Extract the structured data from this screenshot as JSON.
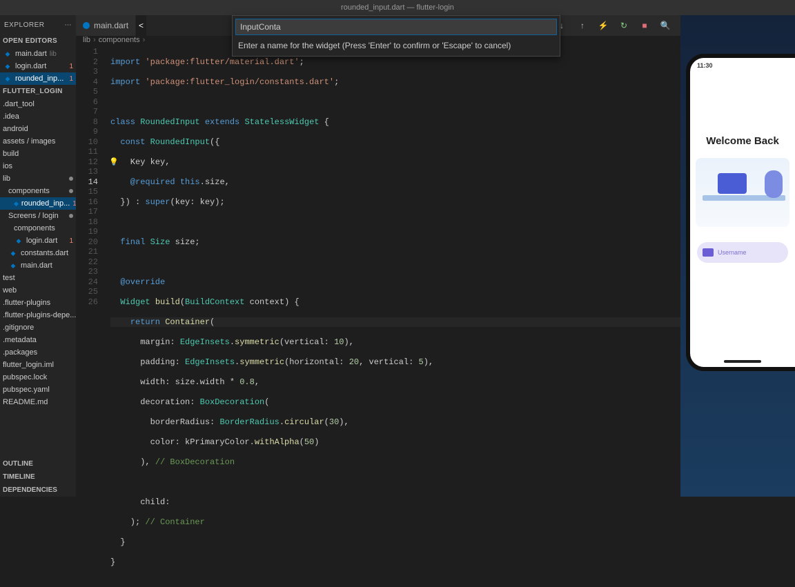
{
  "window_title": "rounded_input.dart — flutter-login",
  "sidebar": {
    "explorer_label": "EXPLORER",
    "open_editors_label": "OPEN EDITORS",
    "open_editors": [
      {
        "name": "main.dart",
        "hint": "lib",
        "error": ""
      },
      {
        "name": "login.dart",
        "hint": "...",
        "error": "1"
      },
      {
        "name": "rounded_inp...",
        "hint": "",
        "error": "1"
      }
    ],
    "project_label": "FLUTTER_LOGIN",
    "tree": [
      {
        "name": ".dart_tool",
        "type": "folder"
      },
      {
        "name": ".idea",
        "type": "folder"
      },
      {
        "name": "android",
        "type": "folder"
      },
      {
        "name": "assets / images",
        "type": "folder"
      },
      {
        "name": "build",
        "type": "folder"
      },
      {
        "name": "ios",
        "type": "folder"
      },
      {
        "name": "lib",
        "type": "folder-open",
        "mod": true
      },
      {
        "name": "components",
        "type": "folder-open",
        "mod": true,
        "indent": 1
      },
      {
        "name": "rounded_inp...",
        "type": "dart",
        "error": "1",
        "indent": 2,
        "selected": true
      },
      {
        "name": "Screens / login",
        "type": "folder-open",
        "mod": true,
        "indent": 1
      },
      {
        "name": "components",
        "type": "folder",
        "indent": 2
      },
      {
        "name": "login.dart",
        "type": "dart",
        "error": "1",
        "indent": 2
      },
      {
        "name": "constants.dart",
        "type": "dart",
        "indent": 1
      },
      {
        "name": "main.dart",
        "type": "dart",
        "indent": 1
      },
      {
        "name": "test",
        "type": "folder"
      },
      {
        "name": "web",
        "type": "folder"
      },
      {
        "name": ".flutter-plugins",
        "type": "file"
      },
      {
        "name": ".flutter-plugins-depe...",
        "type": "file"
      },
      {
        "name": ".gitignore",
        "type": "file"
      },
      {
        "name": ".metadata",
        "type": "file"
      },
      {
        "name": ".packages",
        "type": "file"
      },
      {
        "name": "flutter_login.iml",
        "type": "file"
      },
      {
        "name": "pubspec.lock",
        "type": "file"
      },
      {
        "name": "pubspec.yaml",
        "type": "file"
      },
      {
        "name": "README.md",
        "type": "file"
      }
    ],
    "panels": [
      "OUTLINE",
      "TIMELINE",
      "DEPENDENCIES"
    ]
  },
  "tabs": {
    "main": "main.dart",
    "active_indicator": "<"
  },
  "breadcrumb": [
    "lib",
    "components"
  ],
  "prompt": {
    "value": "InputConta",
    "hint": "Enter a name for the widget (Press 'Enter' to confirm or 'Escape' to cancel)"
  },
  "code": {
    "l1_import": "import ",
    "l1_str": "'package:flutter/material.dart'",
    "l1_end": ";",
    "l2_import": "import ",
    "l2_str": "'package:flutter_login/constants.dart'",
    "l2_end": ";",
    "l4_class": "class ",
    "l4_name": "RoundedInput ",
    "l4_extends": "extends ",
    "l4_parent": "StatelessWidget ",
    "l4_end": "{",
    "l5_const": "  const ",
    "l5_name": "RoundedInput",
    "l5_end": "({",
    "l6": "    Key key,",
    "l7_req": "    @required ",
    "l7_this": "this",
    "l7_end": ".size,",
    "l8_a": "  }) : ",
    "l8_super": "super",
    "l8_end": "(key: key);",
    "l10_final": "  final ",
    "l10_type": "Size ",
    "l10_end": "size;",
    "l12": "  @override",
    "l13_a": "  Widget ",
    "l13_fn": "build",
    "l13_b": "(",
    "l13_type": "BuildContext ",
    "l13_c": "context) {",
    "l14_a": "    return ",
    "l14_fn": "Container",
    "l14_b": "(",
    "l15_a": "      margin: ",
    "l15_type": "EdgeInsets",
    "l15_b": ".",
    "l15_fn": "symmetric",
    "l15_c": "(vertical: ",
    "l15_num": "10",
    "l15_d": "),",
    "l16_a": "      padding: ",
    "l16_type": "EdgeInsets",
    "l16_b": ".",
    "l16_fn": "symmetric",
    "l16_c": "(horizontal: ",
    "l16_n1": "20",
    "l16_d": ", vertical: ",
    "l16_n2": "5",
    "l16_e": "),",
    "l17_a": "      width: size.width * ",
    "l17_num": "0.8",
    "l17_b": ",",
    "l18_a": "      decoration: ",
    "l18_type": "BoxDecoration",
    "l18_b": "(",
    "l19_a": "        borderRadius: ",
    "l19_type": "BorderRadius",
    "l19_b": ".",
    "l19_fn": "circular",
    "l19_c": "(",
    "l19_num": "30",
    "l19_d": "),",
    "l20_a": "        color: kPrimaryColor.",
    "l20_fn": "withAlpha",
    "l20_b": "(",
    "l20_num": "50",
    "l20_c": ")",
    "l21_a": "      ), ",
    "l21_cm": "// BoxDecoration",
    "l23": "      child:",
    "l24_a": "    ); ",
    "l24_cm": "// Container",
    "l25": "  }",
    "l26": "}"
  },
  "line_numbers": [
    "1",
    "2",
    "3",
    "4",
    "5",
    "6",
    "7",
    "8",
    "9",
    "10",
    "11",
    "12",
    "13",
    "14",
    "15",
    "16",
    "17",
    "18",
    "19",
    "20",
    "21",
    "22",
    "23",
    "24",
    "25",
    "26"
  ],
  "phone": {
    "time": "11:30",
    "heading": "Welcome Back",
    "placeholder": "Username"
  }
}
